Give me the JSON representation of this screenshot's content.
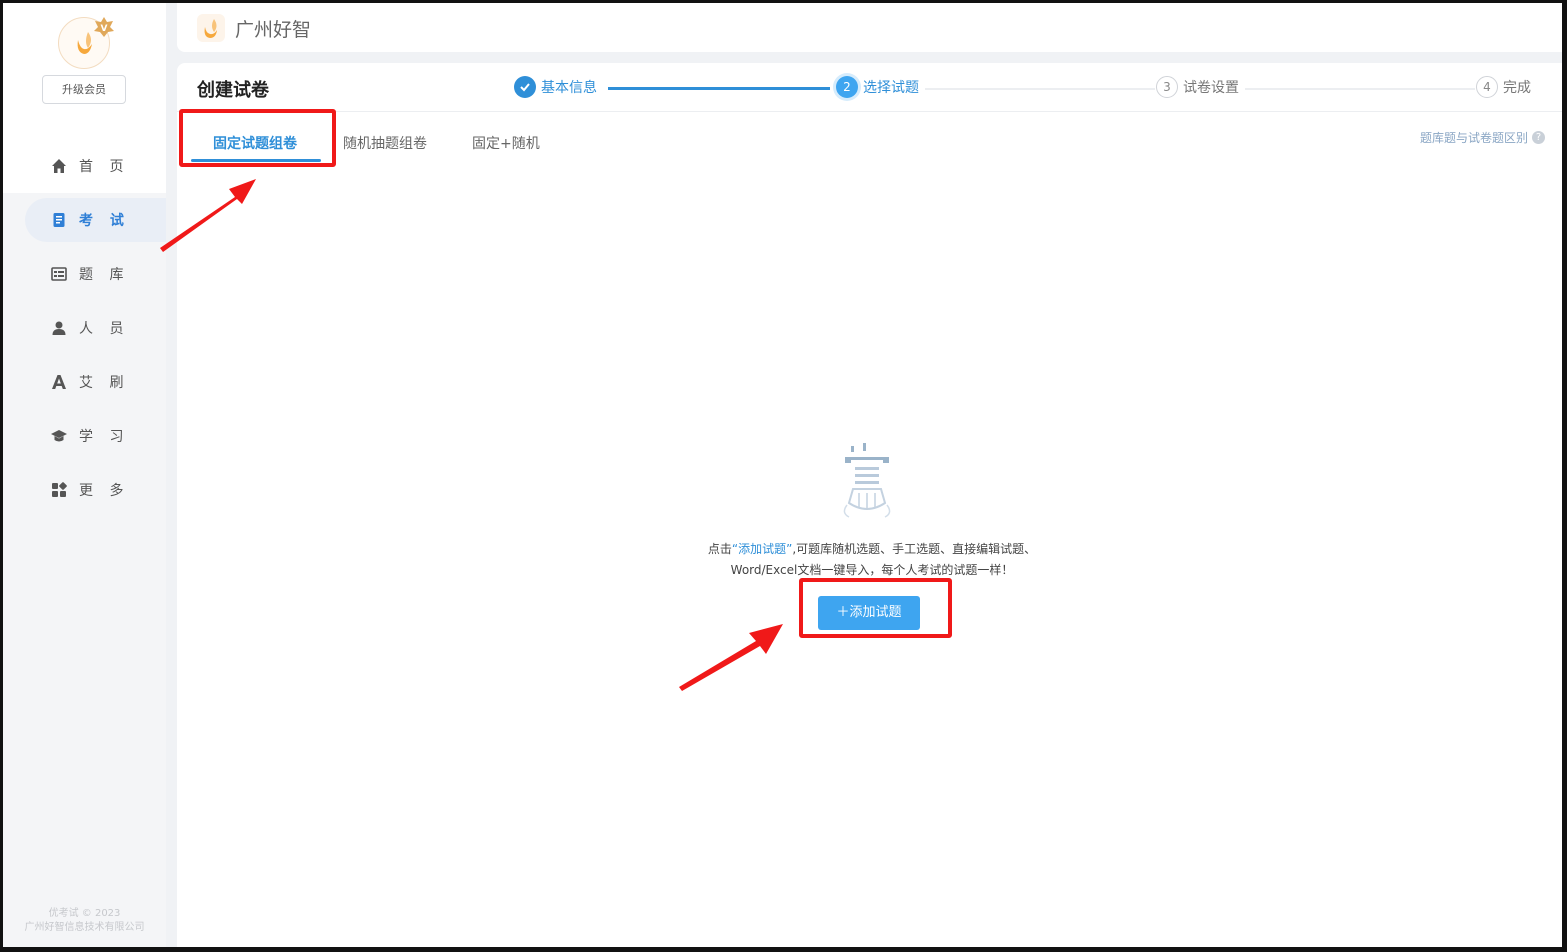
{
  "app": {
    "brand_name": "广州好智",
    "upgrade_label": "升级会员"
  },
  "sidebar": {
    "items": [
      {
        "label": "首 页",
        "icon": "home-icon"
      },
      {
        "label": "考 试",
        "icon": "exam-book-icon",
        "active": true
      },
      {
        "label": "题 库",
        "icon": "question-bank-icon"
      },
      {
        "label": "人 员",
        "icon": "person-icon"
      },
      {
        "label": "艾 刷",
        "icon": "letter-a-icon"
      },
      {
        "label": "学 习",
        "icon": "graduation-cap-icon"
      },
      {
        "label": "更 多",
        "icon": "grid-more-icon"
      }
    ],
    "copyright_line1": "优考试 © 2023",
    "copyright_line2": "广州好智信息技术有限公司"
  },
  "page": {
    "title": "创建试卷",
    "steps": [
      {
        "number": "1",
        "label": "基本信息",
        "state": "done"
      },
      {
        "number": "2",
        "label": "选择试题",
        "state": "current"
      },
      {
        "number": "3",
        "label": "试卷设置",
        "state": "todo"
      },
      {
        "number": "4",
        "label": "完成",
        "state": "todo"
      }
    ],
    "tabs": [
      {
        "label": "固定试题组卷",
        "active": true
      },
      {
        "label": "随机抽题组卷"
      },
      {
        "label": "固定+随机"
      }
    ],
    "help_link": "题库题与试卷题区别",
    "help_icon": "?",
    "empty_state": {
      "prefix": "点击",
      "highlight": "“添加试题”",
      "suffix": ",可题库随机选题、手工选题、直接编辑试题、",
      "line2": "Word/Excel文档一键导入，每个人考试的试题一样！"
    },
    "add_button_label": "＋添加试题"
  },
  "colors": {
    "accent": "#2f8fd8",
    "button": "#3ea5f0",
    "annotation_red": "#f01919"
  }
}
